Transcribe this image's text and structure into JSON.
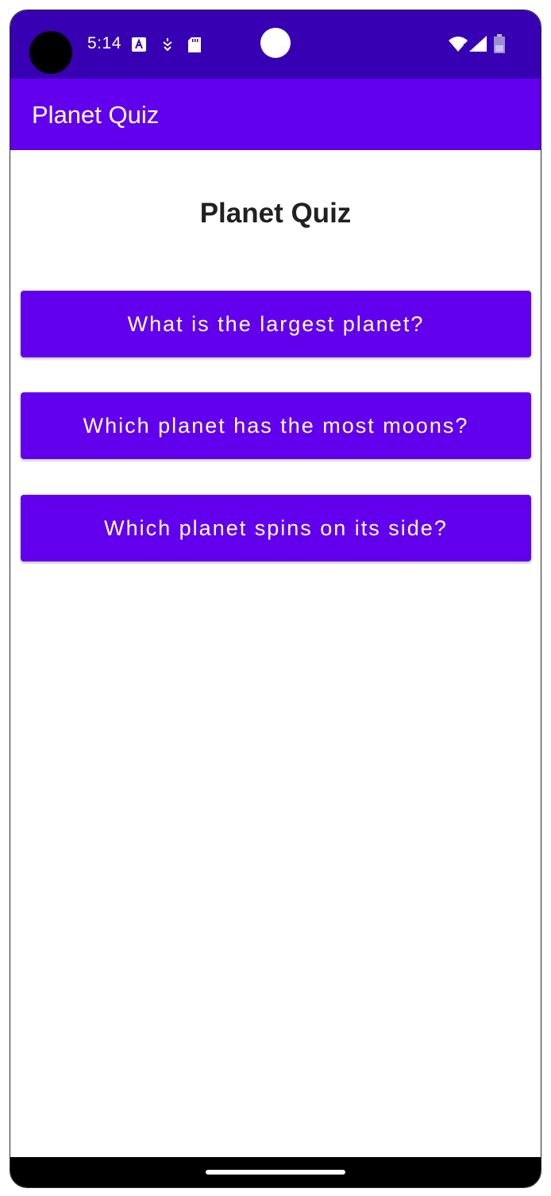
{
  "status_bar": {
    "time": "5:14",
    "icons": [
      "font-a-icon",
      "vpn-key-icon",
      "sd-card-icon",
      "wifi-icon",
      "cell-signal-icon",
      "battery-icon"
    ]
  },
  "app_bar": {
    "title": "Planet Quiz"
  },
  "main": {
    "title": "Planet Quiz",
    "questions": [
      {
        "label": "What is the largest planet?"
      },
      {
        "label": "Which planet has the most moons?"
      },
      {
        "label": "Which planet spins on its side?"
      }
    ]
  },
  "colors": {
    "status_bar": "#3700b3",
    "primary": "#6200ee",
    "text_dark": "#212121"
  }
}
